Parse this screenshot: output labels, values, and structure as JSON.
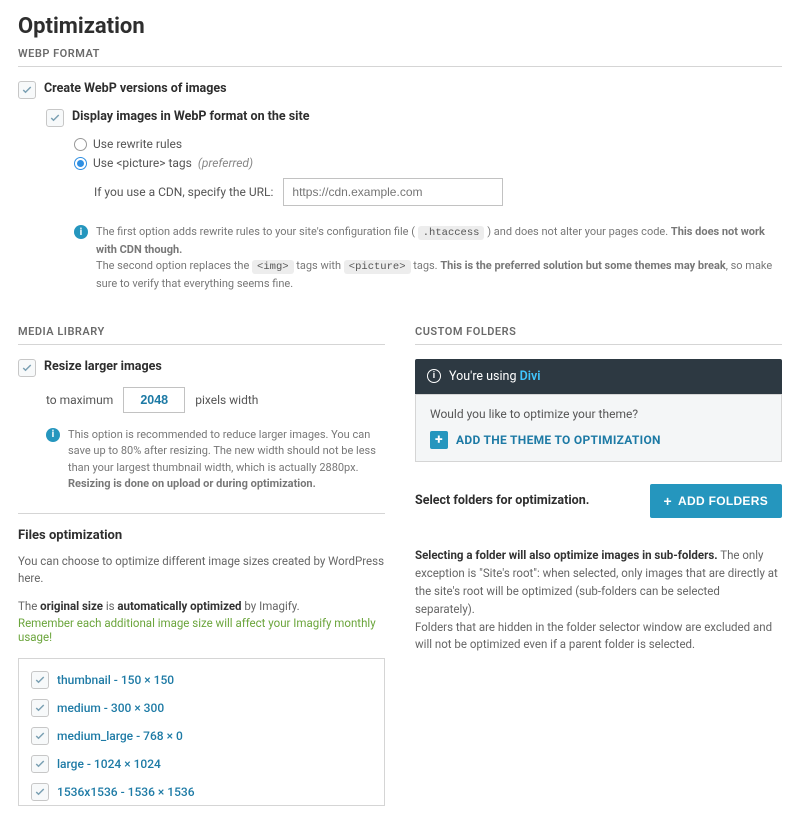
{
  "page": {
    "title": "Optimization"
  },
  "webp": {
    "section_label": "WEBP FORMAT",
    "create_label": "Create WebP versions of images",
    "display_label": "Display images in WebP format on the site",
    "radio_rewrite": "Use rewrite rules",
    "radio_picture_prefix": "Use <picture> tags",
    "radio_picture_suffix": "(preferred)",
    "cdn_label": "If you use a CDN, specify the URL:",
    "cdn_placeholder": "https://cdn.example.com",
    "info_line1_a": "The first option adds rewrite rules to your site's configuration file (",
    "info_code1": ".htaccess",
    "info_line1_b": ") and does not alter your pages code.",
    "info_line1_strong": "This does not work with CDN though.",
    "info_line2_a": "The second option replaces the",
    "info_code2a": "<img>",
    "info_line2_b": "tags with",
    "info_code2b": "<picture>",
    "info_line2_c": "tags.",
    "info_line2_strong": "This is the preferred solution but some themes may break",
    "info_line2_d": ", so make sure to verify that everything seems fine."
  },
  "media": {
    "section_label": "MEDIA LIBRARY",
    "resize_label": "Resize larger images",
    "to_max": "to maximum",
    "width_value": "2048",
    "px_width": "pixels width",
    "info_a": "This option is recommended to reduce larger images. You can save up to 80% after resizing. The new width should not be less than your largest thumbnail width, which is actually 2880px.",
    "info_strong": "Resizing is done on upload or during optimization."
  },
  "files": {
    "title": "Files optimization",
    "line1": "You can choose to optimize different image sizes created by WordPress here.",
    "line2a": "The",
    "line2b": "original size",
    "line2c": "is",
    "line2d": "automatically optimized",
    "line2e": "by Imagify.",
    "line3": "Remember each additional image size will affect your Imagify monthly usage!",
    "sizes": [
      "thumbnail - 150 × 150",
      "medium - 300 × 300",
      "medium_large - 768 × 0",
      "large - 1024 × 1024",
      "1536x1536 - 1536 × 1536"
    ]
  },
  "custom": {
    "section_label": "CUSTOM FOLDERS",
    "using_prefix": "You're using",
    "using_brand": "Divi",
    "optimize_q": "Would you like to optimize your theme?",
    "add_theme": "ADD THE THEME TO OPTIMIZATION",
    "select_label": "Select folders for optimization.",
    "add_folders": "ADD FOLDERS",
    "desc_strong": "Selecting a folder will also optimize images in sub-folders.",
    "desc_body": " The only exception is \"Site's root\": when selected, only images that are directly at the site's root will be optimized (sub-folders can be selected separately).\nFolders that are hidden in the folder selector window are excluded and will not be optimized even if a parent folder is selected."
  }
}
